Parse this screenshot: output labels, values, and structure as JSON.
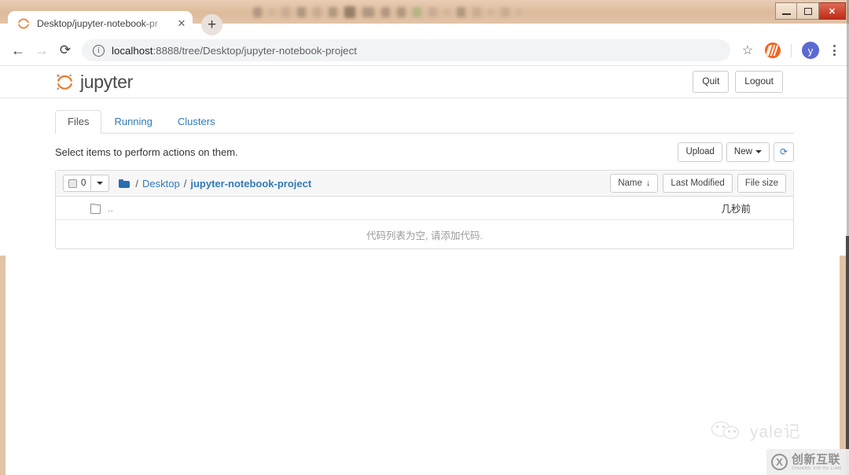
{
  "window": {
    "minimize_label": "Minimize",
    "maximize_label": "Maximize",
    "close_label": "✕"
  },
  "browser": {
    "tab": {
      "title": "Desktop/jupyter-notebook-pr",
      "favicon": "jupyter-favicon",
      "close_label": "✕"
    },
    "new_tab_label": "+",
    "nav": {
      "back_label": "←",
      "forward_label": "→",
      "reload_label": "⟳"
    },
    "omnibox": {
      "info_label": "i",
      "url_host": "localhost",
      "url_path": ":8888/tree/Desktop/jupyter-notebook-project",
      "full_url": "localhost:8888/tree/Desktop/jupyter-notebook-project"
    },
    "actions": {
      "bookmark_label": "☆",
      "extension_name": "extension-icon",
      "avatar_label": "y",
      "menu_label": "kebab-menu"
    }
  },
  "jupyter": {
    "brand": "jupyter",
    "header_buttons": [
      {
        "label": "Quit"
      },
      {
        "label": "Logout"
      }
    ],
    "tabs": [
      {
        "label": "Files",
        "active": true
      },
      {
        "label": "Running",
        "active": false
      },
      {
        "label": "Clusters",
        "active": false
      }
    ],
    "actions_message": "Select items to perform actions on them.",
    "toolbar": {
      "upload_label": "Upload",
      "new_label": "New",
      "refresh_label": "⟳"
    },
    "breadcrumb": {
      "selected_count": "0",
      "folder_icon": "folder-icon",
      "separator": "/",
      "items": [
        {
          "label": "Desktop",
          "bold": false
        },
        {
          "label": "jupyter-notebook-project",
          "bold": true
        }
      ]
    },
    "columns": [
      {
        "label": "Name",
        "sort_arrow": "↓"
      },
      {
        "label": "Last Modified",
        "sort_arrow": ""
      },
      {
        "label": "File size",
        "sort_arrow": ""
      }
    ],
    "files": [
      {
        "icon": "folder-up-icon",
        "name": "..",
        "modified": "几秒前",
        "size": ""
      }
    ],
    "empty_message": "代码列表为空, 请添加代码."
  },
  "watermarks": {
    "wechat_text": "yale记",
    "brand_cn": "创新互联",
    "brand_en": "CHUANG XIN HU LIAN"
  },
  "colors": {
    "jupyter_orange": "#f37726",
    "link_blue": "#337ab7",
    "chrome_tan": "#e3c3a4"
  }
}
